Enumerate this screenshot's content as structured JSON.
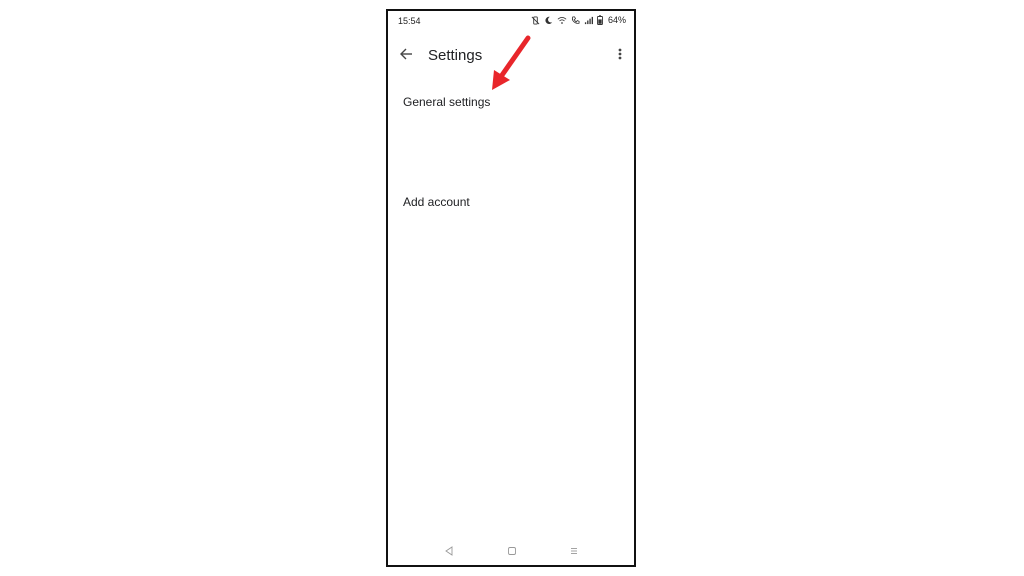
{
  "status_bar": {
    "time": "15:54",
    "battery_percent": "64%",
    "icons": [
      "vibrate-icon",
      "moon-icon",
      "wifi-icon",
      "call-icon",
      "signal-icon",
      "battery-icon"
    ]
  },
  "app_bar": {
    "title": "Settings",
    "back_icon": "arrow-left-icon",
    "menu_icon": "more-vert-icon"
  },
  "settings_list": {
    "items": [
      {
        "label": "General settings"
      },
      {
        "label": "Add account"
      }
    ]
  },
  "nav_bar": {
    "icons": [
      "nav-back-icon",
      "nav-home-icon",
      "nav-recents-icon"
    ]
  },
  "annotation": {
    "arrow_color": "#e8262b"
  }
}
